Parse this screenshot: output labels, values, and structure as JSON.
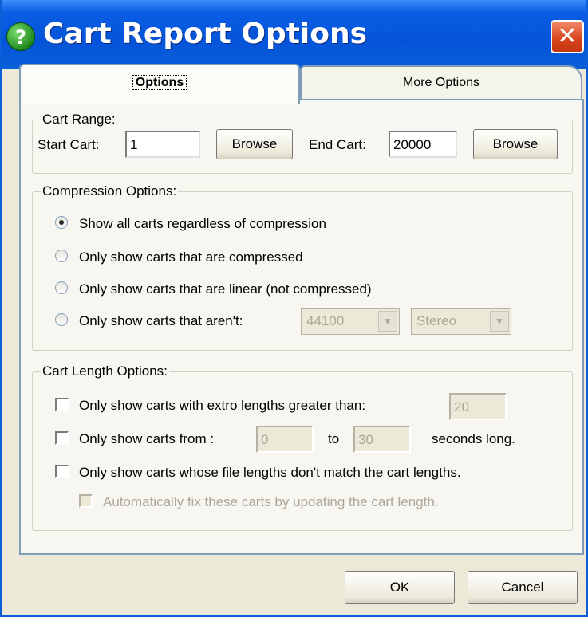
{
  "window": {
    "title": "Cart Report Options",
    "help_glyph": "?",
    "close_glyph": "✕"
  },
  "tabs": [
    {
      "label": "Options",
      "selected": true
    },
    {
      "label": "More Options",
      "selected": false
    }
  ],
  "cart_range": {
    "legend": "Cart Range:",
    "start_label": "Start Cart:",
    "start_value": "1",
    "end_label": "End Cart:",
    "end_value": "20000",
    "browse_label": "Browse"
  },
  "compression": {
    "legend": "Compression Options:",
    "options": [
      {
        "label": "Show all carts regardless of compression",
        "selected": true
      },
      {
        "label": "Only show carts that are compressed",
        "selected": false
      },
      {
        "label": "Only show carts that are linear (not compressed)",
        "selected": false
      },
      {
        "label": "Only show carts that aren't:",
        "selected": false
      }
    ],
    "rate_value": "44100",
    "channel_value": "Stereo"
  },
  "cart_length": {
    "legend": "Cart Length Options:",
    "extro_label": "Only show carts with extro lengths greater than:",
    "extro_value": "20",
    "from_label": "Only show carts from :",
    "from_value": "0",
    "to_label": "to",
    "to_value": "30",
    "seconds_label": "seconds long.",
    "mismatch_label": "Only show carts whose file lengths don't match the cart lengths.",
    "autofix_label": "Automatically fix these carts by updating the cart length."
  },
  "footer": {
    "ok_label": "OK",
    "cancel_label": "Cancel"
  },
  "colors": {
    "titlebar": "#0a5fd8",
    "dialog_bg": "#ece9d8",
    "close_button": "#d8431c"
  }
}
